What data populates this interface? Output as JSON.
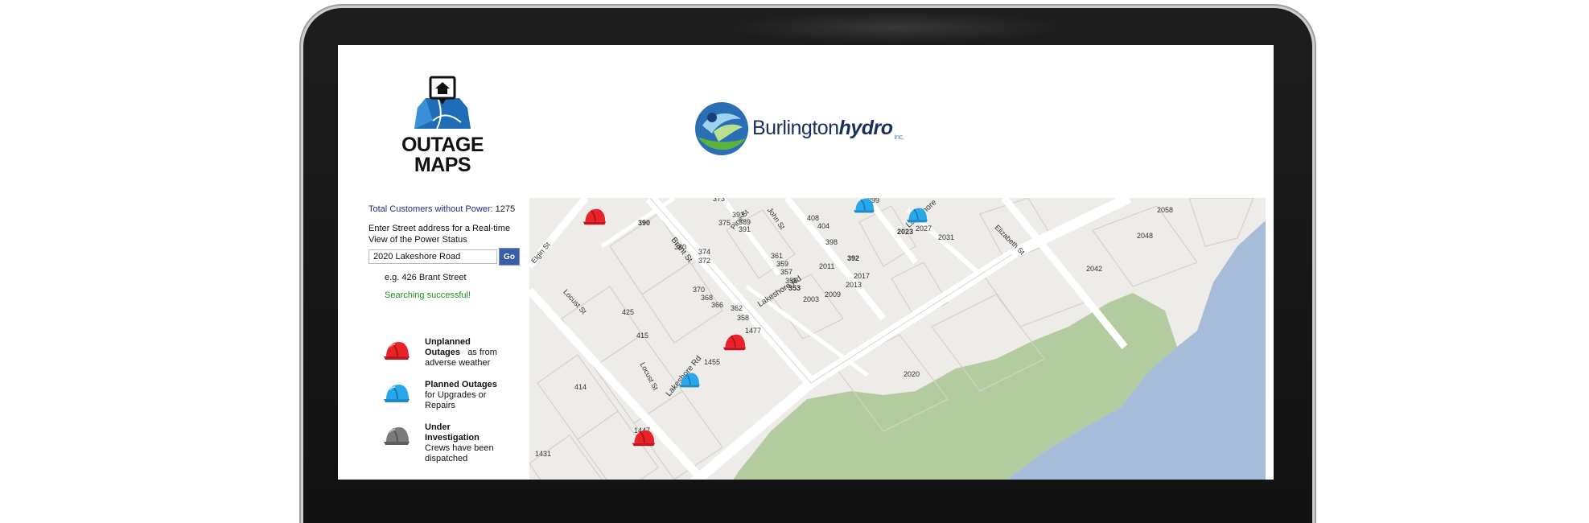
{
  "header": {
    "outage_maps_line1": "OUTAGE",
    "outage_maps_line2": "MAPS",
    "brand_name_regular": "Burlington",
    "brand_name_bold": "hydro",
    "brand_suffix": "inc."
  },
  "sidebar": {
    "total_label": "Total Customers without Power:",
    "total_count": "1275",
    "prompt_line1": "Enter Street address for a Real-time",
    "prompt_line2": "View of the Power Status",
    "search_value": "2020 Lakeshore Road",
    "go_label": "Go",
    "example": "e.g. 426 Brant Street",
    "status": "Searching successful!"
  },
  "legend": {
    "unplanned": {
      "title_line1": "Unplanned",
      "title_line2": "Outages",
      "desc_inline": "as from",
      "desc_line2": "adverse weather",
      "icon": "red-hard-hat-icon",
      "color": "#e8232a"
    },
    "planned": {
      "title": "Planned Outages",
      "desc_line1": "for Upgrades or",
      "desc_line2": "Repairs",
      "icon": "blue-hard-hat-icon",
      "color": "#2aa7e8"
    },
    "investigation": {
      "title_line1": "Under",
      "title_line2": "Investigation",
      "desc_line1": "Crews have been",
      "desc_line2": "dispatched",
      "icon": "gray-hard-hat-icon",
      "color": "#7a7a7a"
    }
  },
  "map": {
    "streets": {
      "brant": "Brant St",
      "lakeshore_rd_1": "Lakeshore Rd",
      "lakeshore_rd_2": "Lakeshore Rd",
      "lakeshore_n": "Lakeshore",
      "elgin": "Elgin St",
      "locust_1": "Locust St",
      "locust_2": "Locust St",
      "pine": "Pine St",
      "john": "John St",
      "elizabeth": "Elizabeth St"
    },
    "numbers": {
      "n390": "390",
      "n393": "393",
      "n375": "375",
      "n389": "389",
      "n391": "391",
      "n380": "380",
      "n374": "374",
      "n372": "372",
      "n408": "408",
      "n404": "404",
      "n398": "398",
      "n361": "361",
      "n359": "359",
      "n357": "357",
      "n355": "355",
      "n353": "353",
      "n392": "392",
      "n2011": "2011",
      "n2017": "2017",
      "n2013": "2013",
      "n2009": "2009",
      "n2003": "2003",
      "n370": "370",
      "n368": "368",
      "n366": "366",
      "n362": "362",
      "n358": "358",
      "n425": "425",
      "n415": "415",
      "n1477": "1477",
      "n1455": "1455",
      "n414": "414",
      "n1447": "1447",
      "n1431": "1431",
      "n2023": "2023",
      "n2027": "2027",
      "n2031": "2031",
      "n2058": "2058",
      "n2048": "2048",
      "n2042": "2042",
      "n2020": "2020",
      "n399": "399",
      "n373": "373"
    },
    "colors": {
      "land": "#eeece8",
      "road": "#ffffff",
      "water": "#a6bcd9",
      "park": "#b2cc9f",
      "block": "#d9d6d1"
    }
  }
}
